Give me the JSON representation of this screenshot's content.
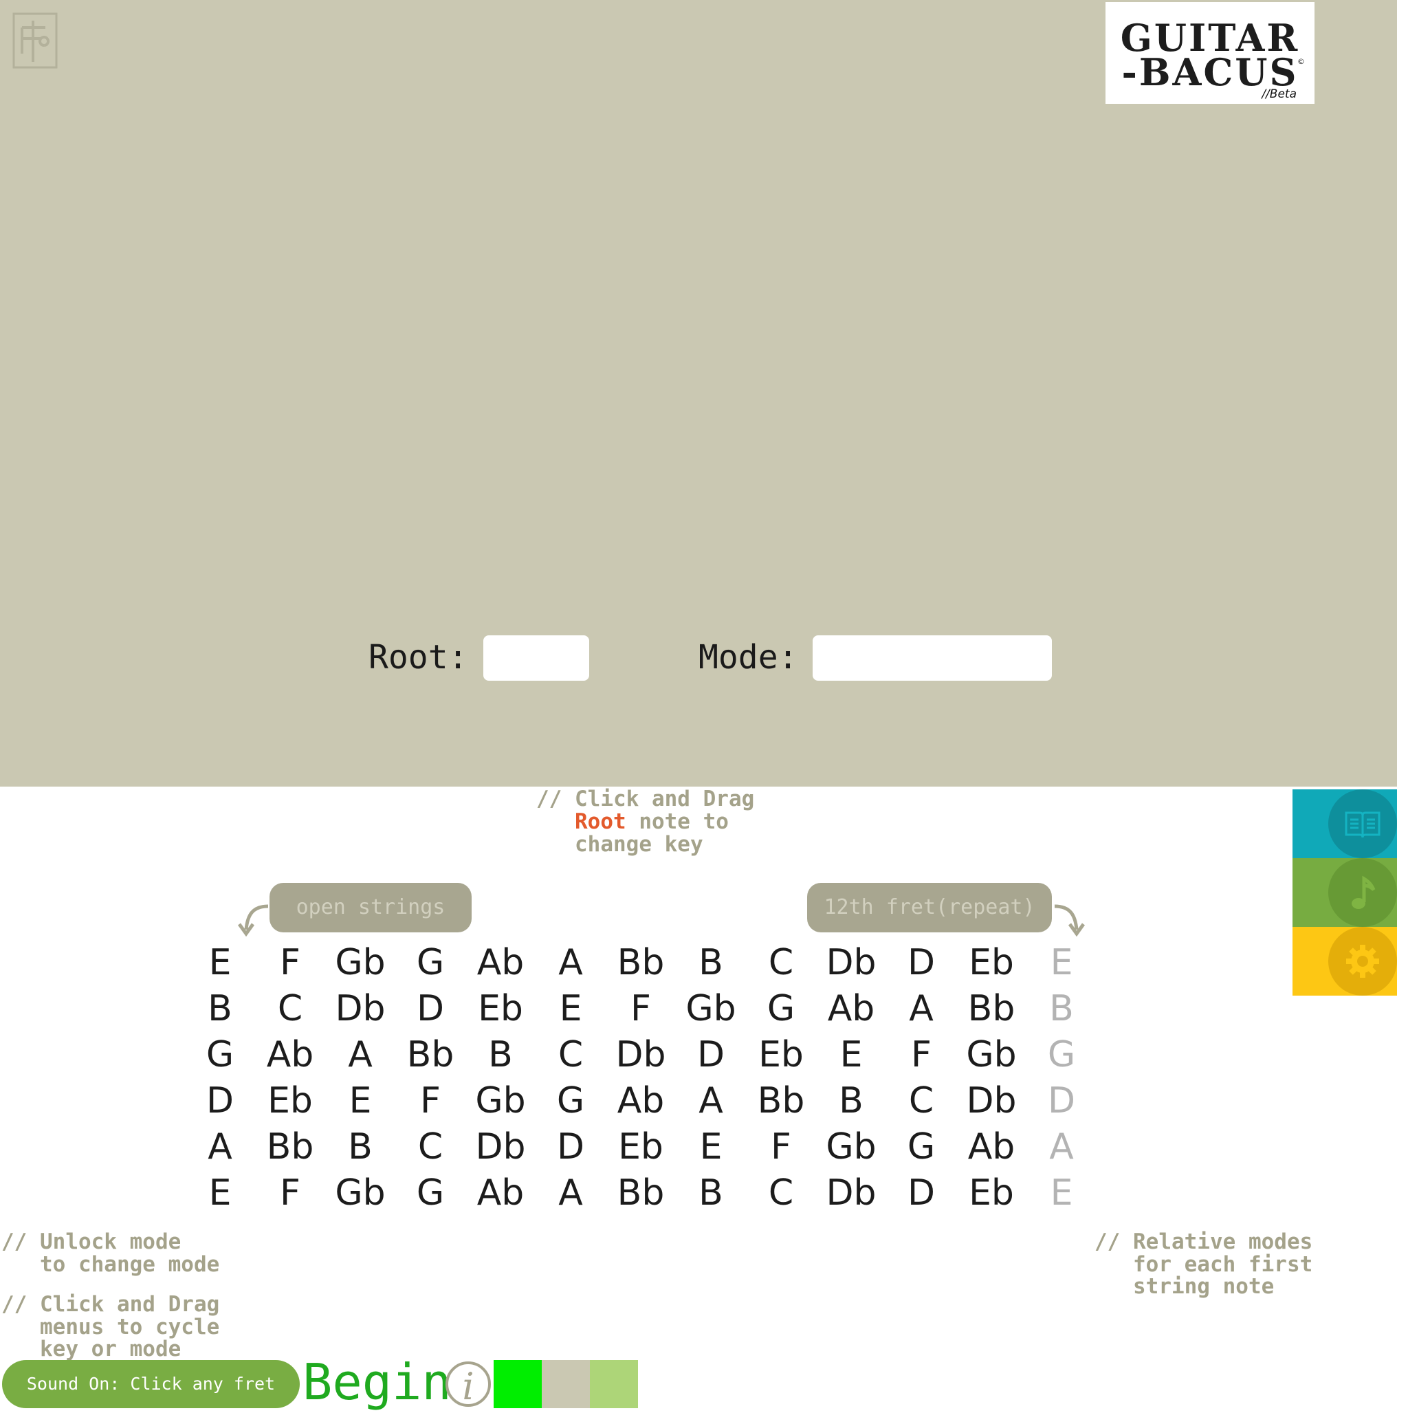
{
  "brand": {
    "line1": "GUITAR",
    "line2": "-BACUS",
    "beta": "//Beta",
    "reg": "©"
  },
  "selectors": {
    "root_label": "Root:",
    "root_value": "",
    "mode_label": "Mode:",
    "mode_value": ""
  },
  "hints": {
    "drag_root_prefix": "// ",
    "drag_root_l1": "Click and Drag",
    "drag_root_root": "Root",
    "drag_root_l2_rest": " note to",
    "drag_root_l3": "change key",
    "unlock_l1": "// Unlock mode",
    "unlock_l2": "   to change mode",
    "cycle_l1": "// Click and Drag",
    "cycle_l2": "   menus to cycle",
    "cycle_l3": "   key or mode",
    "relative_l1": "// Relative modes",
    "relative_l2": "   for each first",
    "relative_l3": "   string note"
  },
  "pills": {
    "open_strings": "open strings",
    "twelfth": "12th fret(repeat)"
  },
  "fretboard": {
    "strings": [
      [
        "E",
        "F",
        "Gb",
        "G",
        "Ab",
        "A",
        "Bb",
        "B",
        "C",
        "Db",
        "D",
        "Eb",
        "E"
      ],
      [
        "B",
        "C",
        "Db",
        "D",
        "Eb",
        "E",
        "F",
        "Gb",
        "G",
        "Ab",
        "A",
        "Bb",
        "B"
      ],
      [
        "G",
        "Ab",
        "A",
        "Bb",
        "B",
        "C",
        "Db",
        "D",
        "Eb",
        "E",
        "F",
        "Gb",
        "G"
      ],
      [
        "D",
        "Eb",
        "E",
        "F",
        "Gb",
        "G",
        "Ab",
        "A",
        "Bb",
        "B",
        "C",
        "Db",
        "D"
      ],
      [
        "A",
        "Bb",
        "B",
        "C",
        "Db",
        "D",
        "Eb",
        "E",
        "F",
        "Gb",
        "G",
        "Ab",
        "A"
      ],
      [
        "E",
        "F",
        "Gb",
        "G",
        "Ab",
        "A",
        "Bb",
        "B",
        "C",
        "Db",
        "D",
        "Eb",
        "E"
      ]
    ]
  },
  "sidebar": [
    {
      "icon": "book-icon",
      "bg": "#10a9b8",
      "circle": "#0e8f9c"
    },
    {
      "icon": "music-note-icon",
      "bg": "#77ac41",
      "circle": "#679a35"
    },
    {
      "icon": "gear-icon",
      "bg": "#fdc714",
      "circle": "#e4ae0a"
    }
  ],
  "footer": {
    "sound": "Sound On: Click any fret",
    "begin": "Begin",
    "info": "i"
  },
  "swatches": [
    "#00ee00",
    "#cac8b2",
    "#add578"
  ],
  "colors": {
    "stage": "#cac8b2",
    "hint": "#a4a28a",
    "root_accent": "#e35a2c",
    "ghost_note": "#b3b3b3"
  }
}
